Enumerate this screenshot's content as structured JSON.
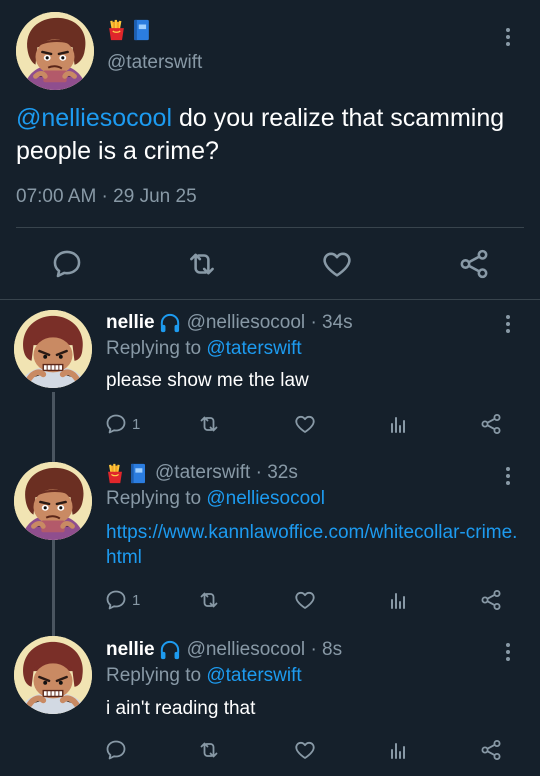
{
  "main_tweet": {
    "badges": [
      "fries-emoji",
      "book-emoji"
    ],
    "handle": "@taterswift",
    "mention": "@nelliesocool",
    "text": " do you realize that scamming people is a crime?",
    "time": "07:00 AM",
    "separator": " · ",
    "date": "29 Jun 25"
  },
  "replies": [
    {
      "name": "nellie",
      "handle": "@nelliesocool",
      "time": "· 34s",
      "replying_prefix": "Replying to ",
      "replying_to": "@taterswift",
      "text": "please show me the law",
      "reply_count": "1"
    },
    {
      "handle": "@taterswift",
      "time": "· 32s",
      "replying_prefix": "Replying to ",
      "replying_to": "@nelliesocool",
      "link": "https://www.kannlawoffice.com/whitecollar-crime.html",
      "reply_count": "1"
    },
    {
      "name": "nellie",
      "handle": "@nelliesocool",
      "time": "· 8s",
      "replying_prefix": "Replying to ",
      "replying_to": "@taterswift",
      "text": "i ain't reading that"
    }
  ],
  "icons": [
    "reply-icon",
    "retweet-icon",
    "like-icon",
    "share-icon",
    "analytics-icon",
    "more-icon",
    "headphones-icon"
  ],
  "colors": {
    "background": "#15202b",
    "link": "#1d9bf0",
    "muted": "#8899a6",
    "divider": "#38444d"
  }
}
